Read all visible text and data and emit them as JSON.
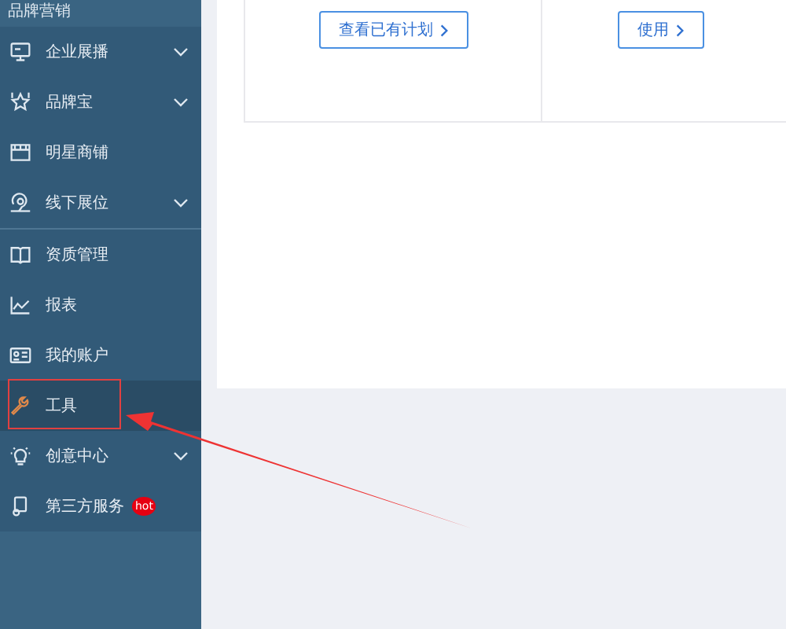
{
  "sidebar": {
    "section_title": "品牌营销",
    "groups": [
      [
        {
          "label": "企业展播",
          "expanded": false,
          "selected": false
        },
        {
          "label": "品牌宝",
          "expanded": false,
          "selected": false
        },
        {
          "label": "明星商铺",
          "selected": false
        },
        {
          "label": "线下展位",
          "expanded": false,
          "selected": false
        }
      ],
      [
        {
          "label": "资质管理",
          "selected": false
        },
        {
          "label": "报表",
          "selected": false
        },
        {
          "label": "我的账户",
          "selected": false
        },
        {
          "label": "工具",
          "selected": true
        },
        {
          "label": "创意中心",
          "expanded": false,
          "selected": false
        },
        {
          "label": "第三方服务",
          "badge": "hot",
          "selected": false
        }
      ]
    ]
  },
  "cards": [
    {
      "button": "查看已有计划"
    },
    {
      "button": "使用"
    }
  ]
}
